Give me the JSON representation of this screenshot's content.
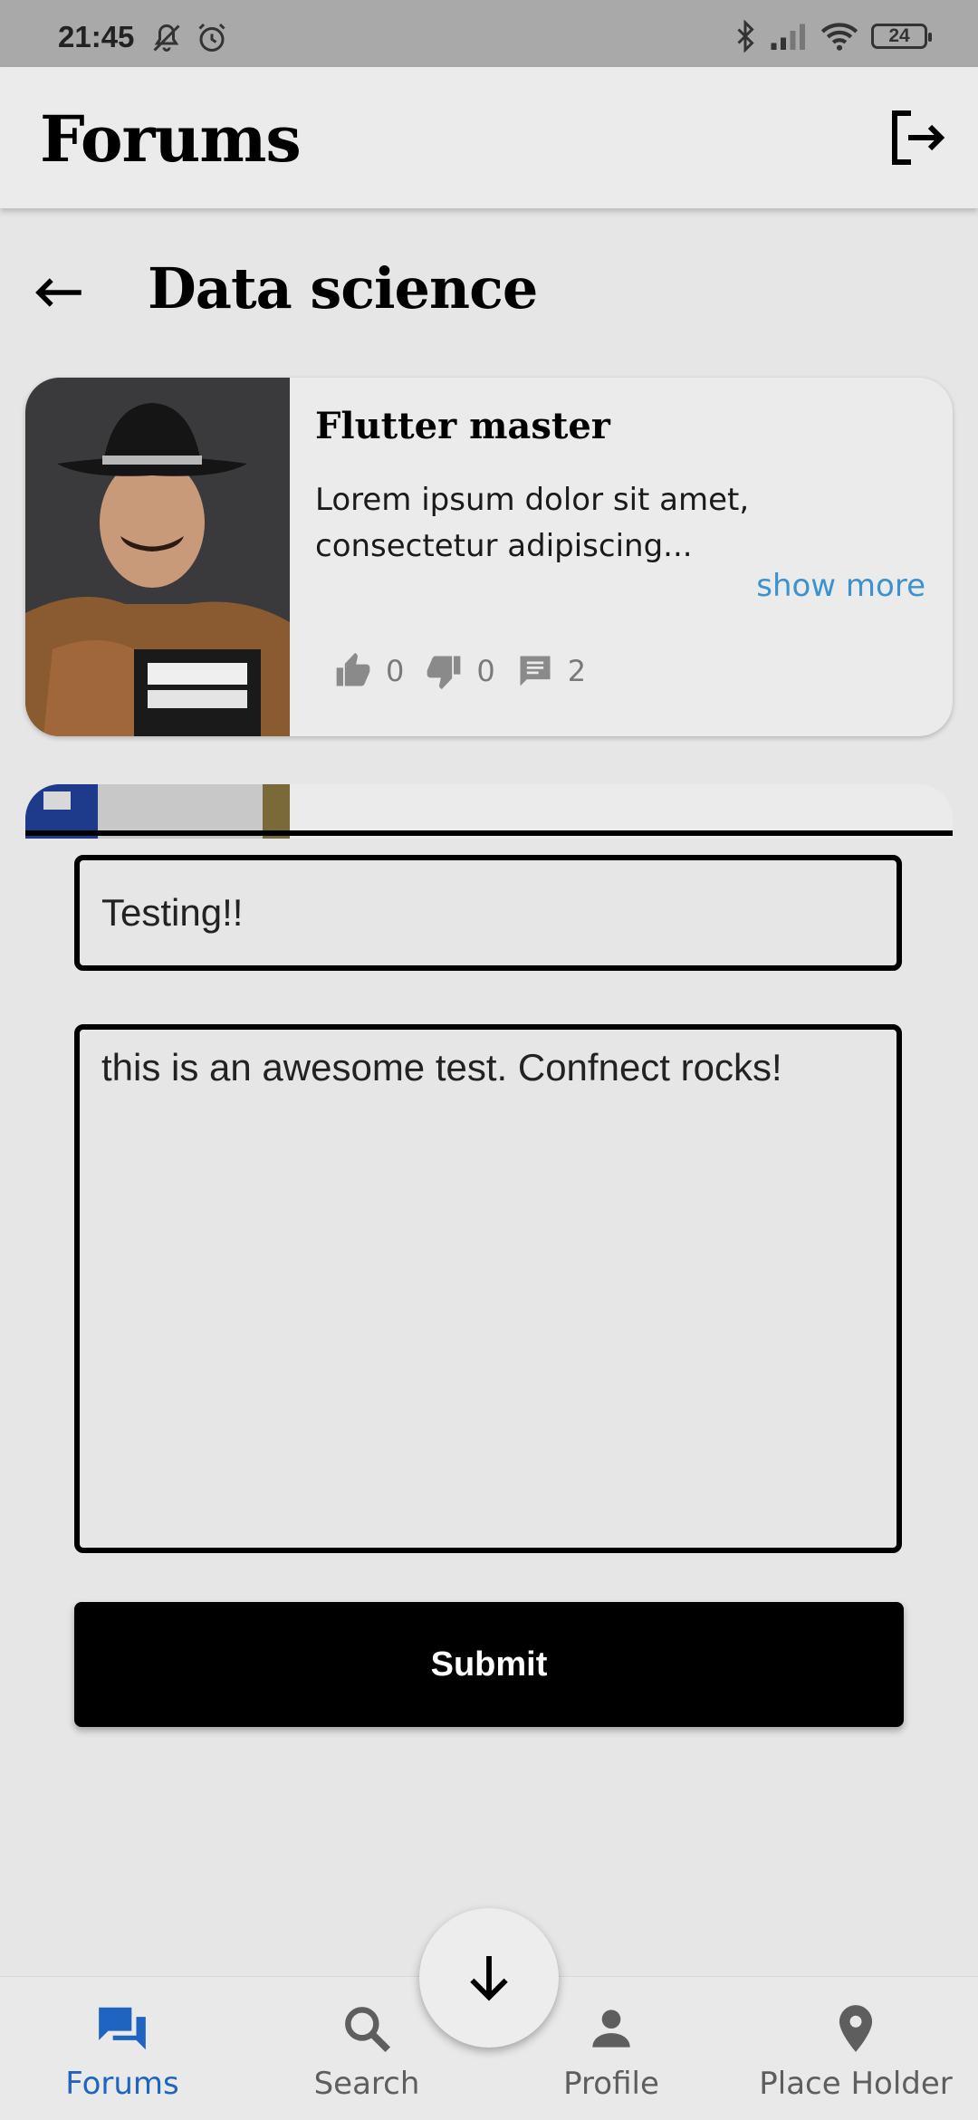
{
  "status_bar": {
    "time": "21:45",
    "battery": "24",
    "icons": [
      "mute-bell-icon",
      "alarm-icon",
      "bluetooth-icon",
      "signal-icon",
      "wifi-icon",
      "battery-icon"
    ]
  },
  "app_bar": {
    "title": "Forums",
    "logout_icon": "logout-icon"
  },
  "page": {
    "title": "Data science",
    "back_icon": "back-arrow-icon"
  },
  "post": {
    "title": "Flutter master",
    "excerpt": "Lorem ipsum dolor sit amet, consectetur adipiscing...",
    "show_more": "show more",
    "likes": "0",
    "dislikes": "0",
    "comments": "2"
  },
  "form": {
    "title_value": "Testing!!",
    "body_value": "this is an awesome test. Confnect rocks!",
    "submit_label": "Submit"
  },
  "fab": {
    "icon": "arrow-down-icon"
  },
  "bottom_nav": {
    "items": [
      {
        "label": "Forums",
        "icon": "forum-icon",
        "active": true
      },
      {
        "label": "Search",
        "icon": "search-icon",
        "active": false
      },
      {
        "label": "Profile",
        "icon": "person-icon",
        "active": false
      },
      {
        "label": "Place Holder",
        "icon": "location-pin-icon",
        "active": false
      }
    ]
  },
  "colors": {
    "accent": "#1e64c0",
    "link": "#3a93d0",
    "background": "#e6e6e6",
    "status_bar": "#a9a9a9"
  }
}
